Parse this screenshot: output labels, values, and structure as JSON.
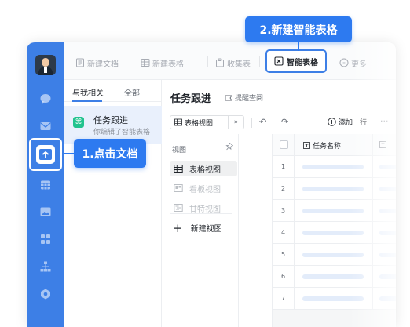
{
  "toolbar": {
    "items": [
      {
        "label": "新建文档",
        "icon": "new-doc-icon"
      },
      {
        "label": "新建表格",
        "icon": "new-sheet-icon"
      },
      {
        "label": "收集表",
        "icon": "form-icon"
      },
      {
        "label": "智能表格",
        "icon": "smart-table-icon",
        "highlighted": true
      },
      {
        "label": "更多",
        "icon": "more-circle-icon"
      }
    ]
  },
  "doclist": {
    "tabs": [
      {
        "label": "与我相关",
        "active": true
      },
      {
        "label": "全部",
        "active": false
      }
    ],
    "items": [
      {
        "title": "任务跟进",
        "subtitle": "你编辑了智能表格",
        "icon_glyph": "⌘",
        "icon_color": "#22c38e"
      }
    ]
  },
  "main": {
    "title": "任务跟进",
    "remind_label": "提醒查阅",
    "view_select_label": "表格视图",
    "view_select_chevron": "»",
    "undo_glyph": "↶",
    "redo_glyph": "↷",
    "add_row_label": "添加一行",
    "more_glyph": "···"
  },
  "views": {
    "heading": "视图",
    "items": [
      {
        "label": "表格视图",
        "active": true,
        "disabled": false,
        "icon": "grid-view-icon"
      },
      {
        "label": "看板视图",
        "active": false,
        "disabled": true,
        "icon": "kanban-view-icon"
      },
      {
        "label": "甘特视图",
        "active": false,
        "disabled": true,
        "icon": "gantt-view-icon"
      }
    ],
    "new_view_label": "新建视图",
    "new_view_glyph": "+"
  },
  "grid": {
    "column_header": "任务名称",
    "row_numbers": [
      "1",
      "2",
      "3",
      "4",
      "5",
      "6",
      "7"
    ]
  },
  "callouts": {
    "step1": "1.点击文档",
    "step2": "2.新建智能表格"
  },
  "colors": {
    "accent": "#3d7fe6",
    "callout": "#2d7af0",
    "doc_icon": "#22c38e"
  }
}
